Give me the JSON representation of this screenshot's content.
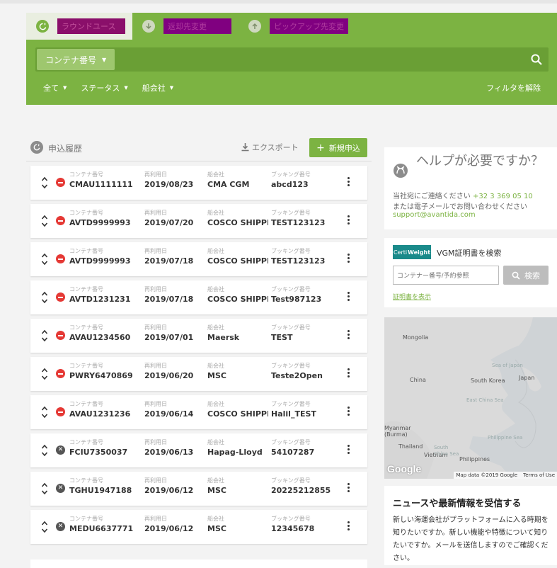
{
  "header": {
    "tabs": [
      {
        "label": "ラウンドユース",
        "icon": "refresh-icon",
        "active": true
      },
      {
        "label": "返却先変更",
        "icon": "arrow-down-icon",
        "active": false
      },
      {
        "label": "ピックアップ先変更",
        "icon": "arrow-up-icon",
        "active": false
      }
    ],
    "search": {
      "field_selector": "コンテナ番号",
      "value": "",
      "placeholder": ""
    },
    "filters": [
      "全て",
      "ステータス",
      "船会社"
    ],
    "clear_filters": "フィルタを解除"
  },
  "history": {
    "title": "申込履歴",
    "export": "エクスポート",
    "new_button": "新規申込"
  },
  "columns": {
    "container": "コンテナ番号",
    "date": "再利用日",
    "carrier": "船会社",
    "booking": "ブッキング番号"
  },
  "rows": [
    {
      "status": "red",
      "container": "CMAU1111111",
      "date": "2019/08/23",
      "carrier": "CMA CGM",
      "booking": "abcd123"
    },
    {
      "status": "red",
      "container": "AVTD9999993",
      "date": "2019/07/20",
      "carrier": "COSCO SHIPPI...",
      "booking": "TEST123123"
    },
    {
      "status": "red",
      "container": "AVTD9999993",
      "date": "2019/07/18",
      "carrier": "COSCO SHIPPI...",
      "booking": "TEST123123"
    },
    {
      "status": "red",
      "container": "AVTD1231231",
      "date": "2019/07/18",
      "carrier": "COSCO SHIPPI...",
      "booking": "Test987123"
    },
    {
      "status": "red",
      "container": "AVAU1234560",
      "date": "2019/07/01",
      "carrier": "Maersk",
      "booking": "TEST"
    },
    {
      "status": "red",
      "container": "PWRY6470869",
      "date": "2019/06/20",
      "carrier": "MSC",
      "booking": "Teste2Open"
    },
    {
      "status": "red",
      "container": "AVAU1231236",
      "date": "2019/06/14",
      "carrier": "COSCO SHIPPI...",
      "booking": "Halil_TEST"
    },
    {
      "status": "dark",
      "container": "FCIU7350037",
      "date": "2019/06/13",
      "carrier": "Hapag-Lloyd",
      "booking": "54107287"
    },
    {
      "status": "dark",
      "container": "TGHU1947188",
      "date": "2019/06/12",
      "carrier": "MSC",
      "booking": "20225212855"
    },
    {
      "status": "dark",
      "container": "MEDU6637771",
      "date": "2019/06/12",
      "carrier": "MSC",
      "booking": "12345678"
    }
  ],
  "help": {
    "title": "ヘルプが必要ですか？",
    "line1_prefix": "当社宛にご連絡ください",
    "phone": "+32 3 369 05 10",
    "line2": "または電子メールでお問い合わせください",
    "email": "support@avantida.com"
  },
  "vgm": {
    "logo_a": "Certi",
    "logo_b": "Weight",
    "title": "VGM証明書を検索",
    "placeholder": "コンテナー番号/予約参照",
    "search_button": "検索",
    "show_cert": "証明書を表示"
  },
  "map": {
    "labels": [
      "Mongolia",
      "China",
      "South Korea",
      "Japan",
      "Myanmar (Burma)",
      "Thailand",
      "Vietnam",
      "Philippines"
    ],
    "seas": [
      "Sea of Japan",
      "East China Sea",
      "Philippine Sea",
      "South China Sea"
    ],
    "logo": "Google",
    "attribution": "Map data ©2019 Google",
    "terms": "Terms of Use"
  },
  "news": {
    "title": "ニュースや最新情報を受信する",
    "body": "新しい海運会社がプラットフォームに入る時期を知りたいですか。新しい機能や特徴について知りたいですか。メールを送信しますのでご確認ください。"
  },
  "colors": {
    "brand_green": "#7cb342",
    "danger_red": "#e53935",
    "teal": "#1a8a8a"
  }
}
